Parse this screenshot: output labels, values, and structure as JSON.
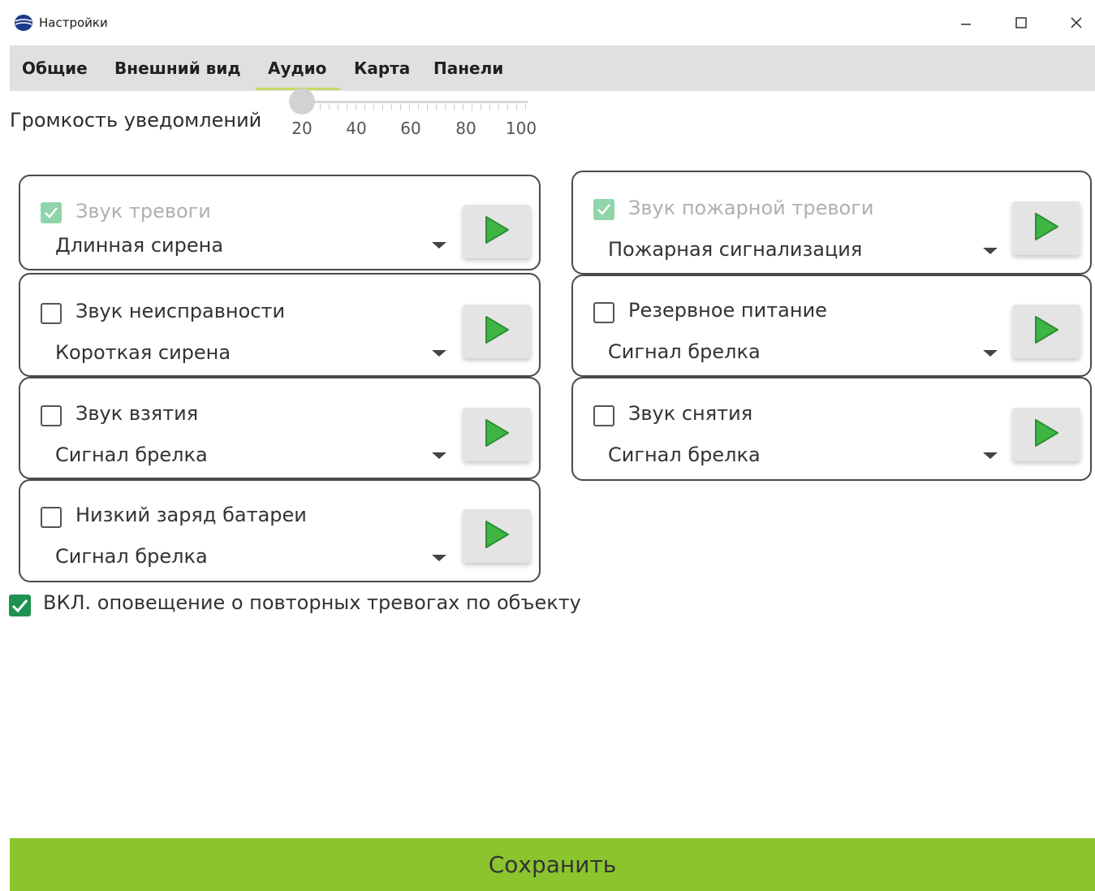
{
  "window": {
    "title": "Настройки",
    "icon": "app-logo-icon",
    "controls": [
      "minimize-icon",
      "maximize-icon",
      "close-icon"
    ]
  },
  "tabs": [
    {
      "label": "Общие",
      "active": false
    },
    {
      "label": "Внешний вид",
      "active": false
    },
    {
      "label": "Аудио",
      "active": true
    },
    {
      "label": "Карта",
      "active": false
    },
    {
      "label": "Панели",
      "active": false
    }
  ],
  "volume": {
    "label": "Громкость уведомлений",
    "value": 0,
    "ticks": [
      "20",
      "40",
      "60",
      "80",
      "100"
    ]
  },
  "sounds": {
    "left": [
      {
        "label": "Звук тревоги",
        "checked": true,
        "disabled": true,
        "value": "Длинная сирена"
      },
      {
        "label": "Звук неисправности",
        "checked": false,
        "disabled": false,
        "value": "Короткая сирена"
      },
      {
        "label": "Звук взятия",
        "checked": false,
        "disabled": false,
        "value": "Сигнал брелка"
      },
      {
        "label": "Низкий заряд батареи",
        "checked": false,
        "disabled": false,
        "value": "Сигнал брелка"
      }
    ],
    "right": [
      {
        "label": "Звук пожарной тревоги",
        "checked": true,
        "disabled": true,
        "value": "Пожарная сигнализация"
      },
      {
        "label": "Резервное питание",
        "checked": false,
        "disabled": false,
        "value": "Сигнал брелка"
      },
      {
        "label": "Звук снятия",
        "checked": false,
        "disabled": false,
        "value": "Сигнал брелка"
      }
    ]
  },
  "repeat_alarm": {
    "label": "ВКЛ. оповещение о повторных тревогах по объекту",
    "checked": true
  },
  "save_label": "Сохранить",
  "colors": {
    "accent": "#8bc52e",
    "tab_underline": "#c5d96a",
    "play_icon": "#3fb544",
    "checkbox_checked": "#1f9150",
    "checkbox_disabled": "#8fd5a9"
  }
}
